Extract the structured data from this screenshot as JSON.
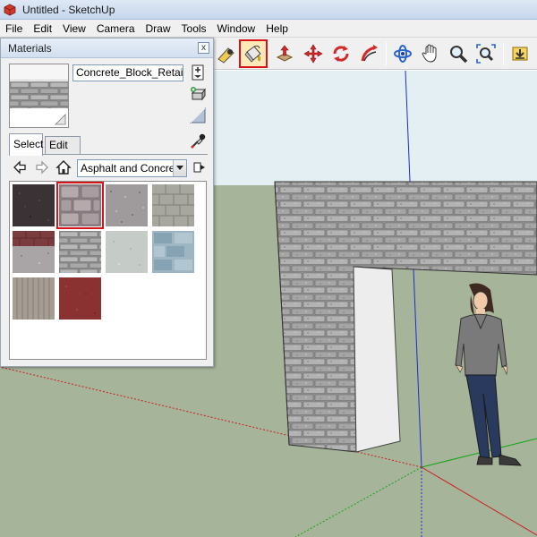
{
  "window": {
    "title": "Untitled - SketchUp"
  },
  "menu": [
    "File",
    "Edit",
    "View",
    "Camera",
    "Draw",
    "Tools",
    "Window",
    "Help"
  ],
  "toolbar": {
    "selected_tool": "paint-bucket",
    "tools": [
      "tape-measure-icon",
      "paint-bucket-icon",
      "push-pull-icon",
      "move-icon",
      "rotate-icon",
      "follow-me-icon",
      "orbit-icon",
      "pan-icon",
      "zoom-icon",
      "zoom-extents-icon",
      "get-models-icon"
    ]
  },
  "materials_panel": {
    "title": "Materials",
    "close_label": "x",
    "material_name": "Concrete_Block_Retaining",
    "tabs": {
      "select": "Select",
      "edit": "Edit"
    },
    "library": "Asphalt and Concrete",
    "swatches": [
      {
        "name": "Asphalt dark",
        "selected": false
      },
      {
        "name": "Concrete block retaining",
        "selected": true
      },
      {
        "name": "Aggregate",
        "selected": false
      },
      {
        "name": "Concrete block",
        "selected": false
      },
      {
        "name": "Red aggregate",
        "selected": false
      },
      {
        "name": "Stone block",
        "selected": false
      },
      {
        "name": "Concrete light",
        "selected": false
      },
      {
        "name": "Blue paving",
        "selected": false
      },
      {
        "name": "Concrete form",
        "selected": false
      },
      {
        "name": "Red asphalt",
        "selected": false
      }
    ]
  },
  "colors": {
    "sky": "#e3eff3",
    "ground": "#a6b49a",
    "selection": "#d7141a",
    "axis_blue": "#1c2bd6",
    "axis_red": "#cc1f1f",
    "axis_green": "#12a612"
  }
}
